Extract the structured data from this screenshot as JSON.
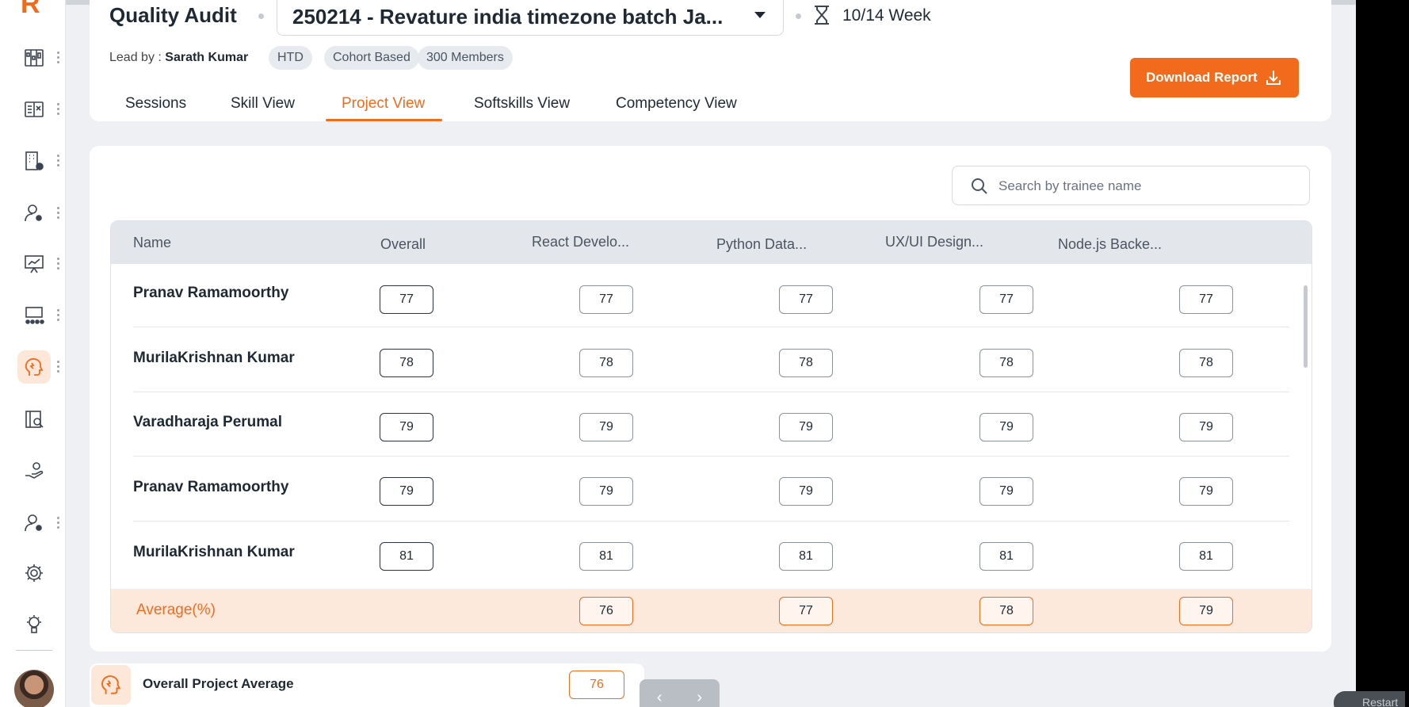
{
  "header": {
    "title": "Quality Audit",
    "batch_name": "250214 - Revature india timezone batch Ja...",
    "week": "10/14 Week",
    "lead_label": "Lead by :",
    "lead_name": "Sarath Kumar",
    "chips": [
      "HTD",
      "Cohort Based",
      "300 Members"
    ],
    "download_label": "Download Report",
    "tabs": [
      {
        "label": "Sessions",
        "active": false
      },
      {
        "label": "Skill View",
        "active": false
      },
      {
        "label": "Project View",
        "active": true
      },
      {
        "label": "Softskills View",
        "active": false
      },
      {
        "label": "Competency View",
        "active": false
      }
    ]
  },
  "search": {
    "placeholder": "Search by trainee name",
    "value": ""
  },
  "table": {
    "columns": [
      "Name",
      "Overall",
      "React Develo...",
      "Python Data...",
      "UX/UI Design...",
      "Node.js Backe..."
    ],
    "rows": [
      {
        "name": "Pranav Ramamoorthy",
        "scores": [
          "77",
          "77",
          "77",
          "77",
          "77"
        ]
      },
      {
        "name": "MurilaKrishnan Kumar",
        "scores": [
          "78",
          "78",
          "78",
          "78",
          "78"
        ]
      },
      {
        "name": "Varadharaja Perumal",
        "scores": [
          "79",
          "79",
          "79",
          "79",
          "79"
        ]
      },
      {
        "name": "Pranav Ramamoorthy",
        "scores": [
          "79",
          "79",
          "79",
          "79",
          "79"
        ]
      },
      {
        "name": "MurilaKrishnan Kumar",
        "scores": [
          "81",
          "81",
          "81",
          "81",
          "81"
        ]
      }
    ],
    "average": {
      "label": "Average(%)",
      "scores": [
        "76",
        "77",
        "78",
        "79"
      ]
    }
  },
  "overall_project_average": {
    "label": "Overall Project Average",
    "value": "76"
  },
  "pager": {
    "prev": "‹",
    "next": "›"
  },
  "restart_label": "Restart",
  "colors": {
    "accent": "#f26b1d",
    "background": "#eef0f3",
    "header_row": "#e3e7ec",
    "average_row": "#fde8dc"
  },
  "sidebar_icons": [
    "dashboard-icon",
    "book-icon",
    "building-icon",
    "user-settings-icon",
    "presentation-icon",
    "network-icon",
    "brain-icon",
    "library-icon",
    "hand-support-icon",
    "user-gear-icon",
    "settings-icon",
    "ai-brain-icon"
  ]
}
